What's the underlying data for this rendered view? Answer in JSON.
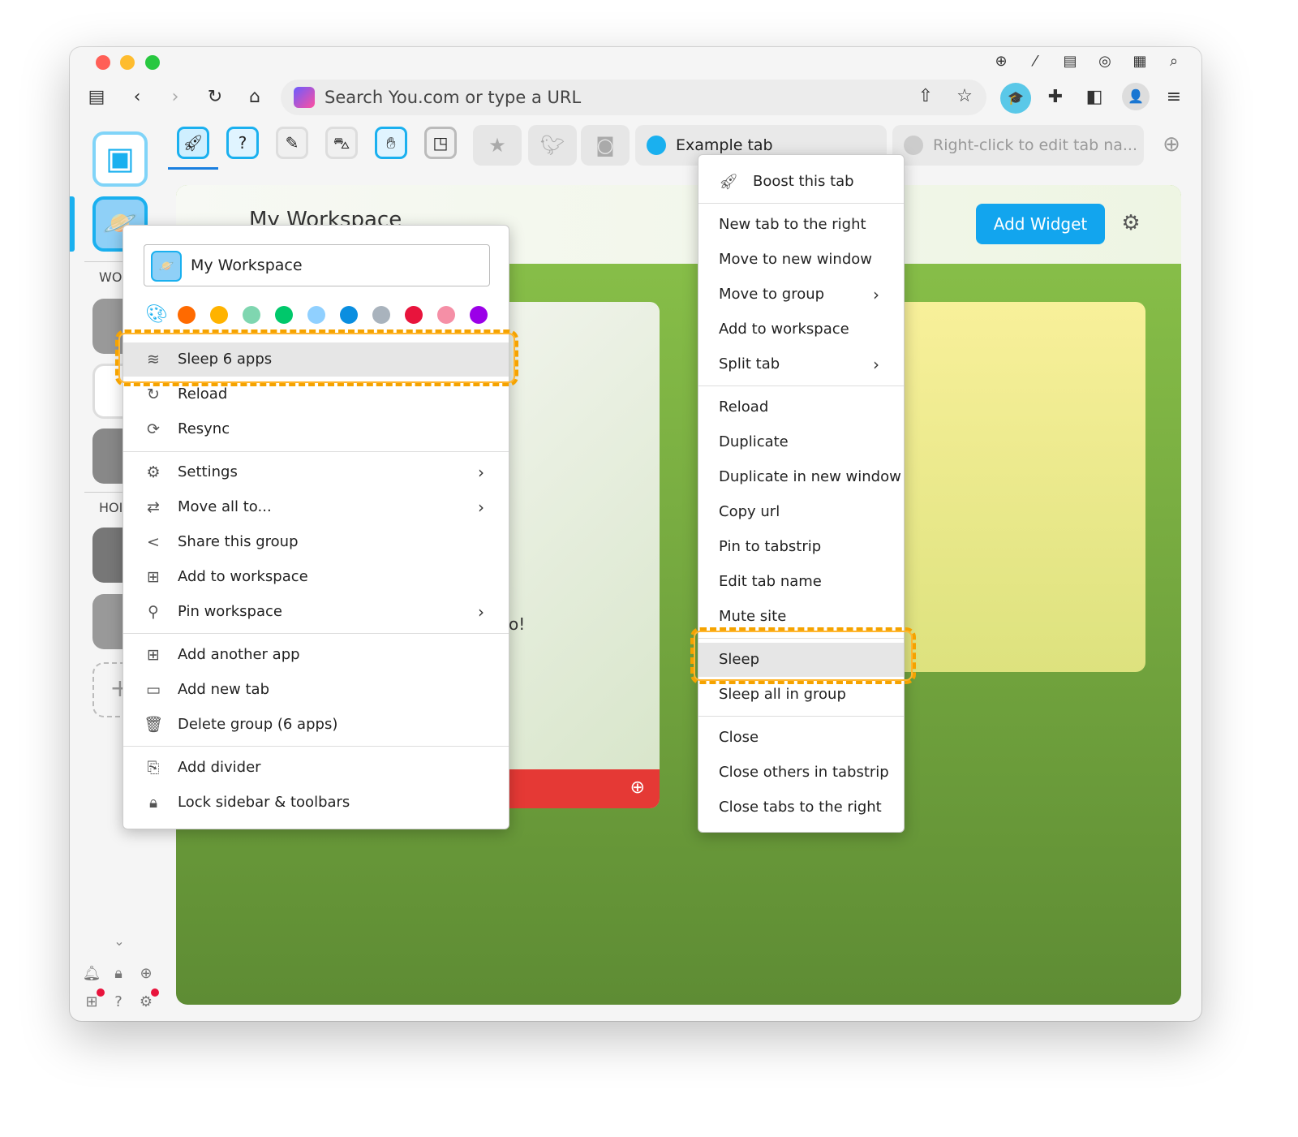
{
  "toolbar": {
    "url_placeholder": "Search You.com or type a URL"
  },
  "tabs": {
    "example": "Example tab",
    "placeholder_tab": "Right-click to edit tab na..."
  },
  "sidebar": {
    "section_work": "WO",
    "section_home": "HOI"
  },
  "workspace": {
    "title": "My Workspace",
    "add_widget": "Add Widget",
    "partial_text": "o!"
  },
  "left_menu": {
    "name_value": "My Workspace",
    "colors": [
      "#ff6a00",
      "#ffb300",
      "#7fd6b0",
      "#00c86b",
      "#90d0ff",
      "#0a8ee0",
      "#a9b3bd",
      "#e8143c",
      "#f58fa6",
      "#9b00e8"
    ],
    "items": [
      {
        "label": "Sleep 6 apps",
        "icon": "sleep-icon"
      },
      {
        "label": "Reload",
        "icon": "reload-icon"
      },
      {
        "label": "Resync",
        "icon": "resync-icon"
      },
      {
        "label": "Settings",
        "icon": "gear-icon",
        "submenu": true
      },
      {
        "label": "Move all to...",
        "icon": "swap-icon",
        "submenu": true
      },
      {
        "label": "Share this group",
        "icon": "share-icon"
      },
      {
        "label": "Add to workspace",
        "icon": "grid-icon"
      },
      {
        "label": "Pin workspace",
        "icon": "pin-icon",
        "submenu": true
      },
      {
        "label": "Add another app",
        "icon": "add-app-icon"
      },
      {
        "label": "Add new tab",
        "icon": "tab-icon"
      },
      {
        "label": "Delete group (6 apps)",
        "icon": "trash-icon"
      },
      {
        "label": "Add divider",
        "icon": "divider-icon"
      },
      {
        "label": "Lock sidebar & toolbars",
        "icon": "lock-icon"
      }
    ]
  },
  "right_menu": {
    "items": [
      {
        "label": "Boost this tab"
      },
      {
        "label": "New tab to the right"
      },
      {
        "label": "Move to new window"
      },
      {
        "label": "Move to group",
        "submenu": true
      },
      {
        "label": "Add to workspace"
      },
      {
        "label": "Split tab",
        "submenu": true
      },
      {
        "label": "Reload"
      },
      {
        "label": "Duplicate"
      },
      {
        "label": "Duplicate in new window"
      },
      {
        "label": "Copy url"
      },
      {
        "label": "Pin to tabstrip"
      },
      {
        "label": "Edit tab name"
      },
      {
        "label": "Mute site"
      },
      {
        "label": "Sleep"
      },
      {
        "label": "Sleep all in group"
      },
      {
        "label": "Close"
      },
      {
        "label": "Close others in tabstrip"
      },
      {
        "label": "Close tabs to the right"
      }
    ]
  },
  "colors": {
    "accent": "#1ab0ef",
    "highlight": "#f5a300",
    "widget_red": "#e53935"
  }
}
